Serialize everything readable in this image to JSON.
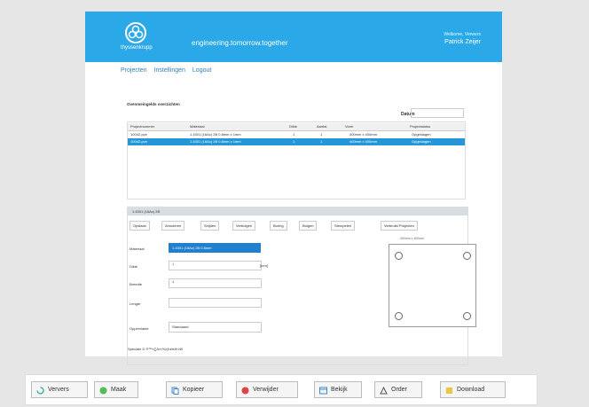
{
  "header": {
    "logo_text": "thyssenkrupp",
    "tagline": "engineering.tomorrow.together",
    "welcome": "Welkome, Verwers",
    "user": "Patrick Zeijer"
  },
  "nav": {
    "items": [
      "Projecten",
      "Instellingen",
      "Logout"
    ]
  },
  "section": {
    "title": "Ovenmeingelds overzichten",
    "date_label": "Datum",
    "date_value": ""
  },
  "grid": {
    "columns": [
      "Projectnummer",
      "Materiaal",
      "Dikte",
      "Aantal",
      "Vorm",
      "Projectstatus"
    ],
    "rows": [
      [
        "10042-pve",
        "1.4301 (16Ac) 2B 0.8mm x 1mm",
        "1",
        "1",
        "400mm x 400mm",
        "Opgeslagen"
      ],
      [
        "10042-pve",
        "1.4301 (16Ac) 2B 0.8mm x 1mm",
        "1",
        "1",
        "400mm x 400mm",
        "Opgeslagen"
      ]
    ]
  },
  "panel": {
    "title": "1.4301 (16Ac) 2B",
    "tabs": [
      "Opslaan",
      "Annuleren",
      "Snijden",
      "Verbuigen",
      "Boring",
      "Buigen",
      "Stempelen",
      "Verbruikt Projecten"
    ],
    "fields": {
      "material_label": "Materiaal",
      "material_value": "1.4301 (16Ac) 2B 0.8mm",
      "dikte_label": "Dikte",
      "dikte_value": "1",
      "dikte_unit": "[mm]",
      "breedte_label": "Breedte",
      "breedte_value": "1",
      "lengte_label": "Lengte",
      "lengte_value": "",
      "finish_label": "Oppervlakte",
      "finish_value": "Standaard"
    },
    "preview_label": "400mm x 400mm",
    "special_chars": "Speciale D ®™±∑∆∞√≤≥∫≈≠π∂≈◊Ø"
  },
  "toolbar": {
    "buttons": [
      {
        "label": "Ververs",
        "icon": "refresh-icon"
      },
      {
        "label": "Maak",
        "icon": "add-icon"
      },
      {
        "label": "Kopieer",
        "icon": "copy-icon"
      },
      {
        "label": "Verwijder",
        "icon": "delete-icon"
      },
      {
        "label": "Bekijk",
        "icon": "view-icon"
      },
      {
        "label": "Order",
        "icon": "order-icon"
      },
      {
        "label": "Download",
        "icon": "download-icon"
      }
    ]
  },
  "colors": {
    "brand": "#2aa8e8",
    "selected_row": "#2596d8",
    "link": "#2a7fc0"
  }
}
